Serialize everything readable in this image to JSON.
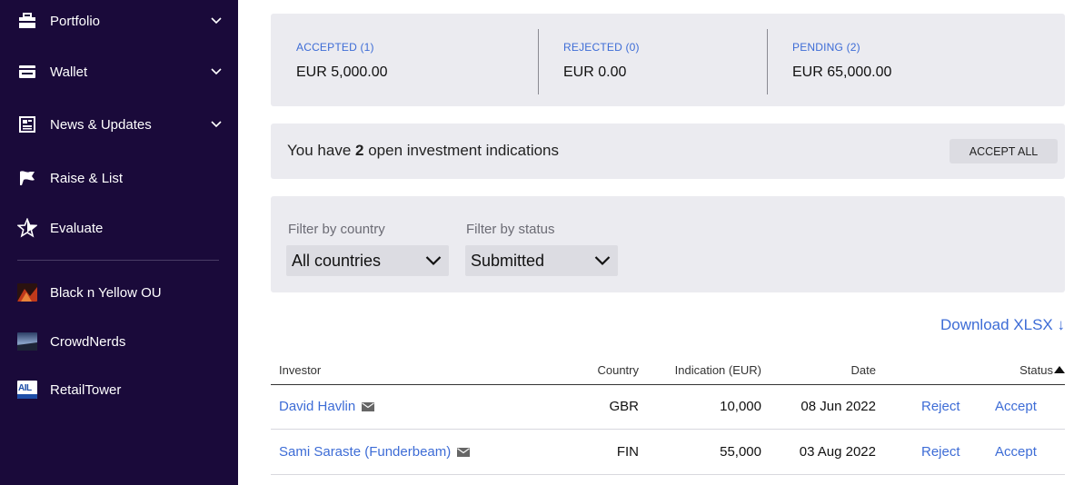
{
  "sidebar": {
    "nav": [
      {
        "label": "Portfolio",
        "icon": "briefcase-icon",
        "has_chevron": true
      },
      {
        "label": "Wallet",
        "icon": "wallet-icon",
        "has_chevron": true
      },
      {
        "label": "News & Updates",
        "icon": "newspaper-icon",
        "has_chevron": true
      },
      {
        "label": "Raise & List",
        "icon": "flag-icon",
        "has_chevron": false
      },
      {
        "label": "Evaluate",
        "icon": "star-icon",
        "has_chevron": false
      }
    ],
    "companies": [
      {
        "label": "Black n Yellow OU"
      },
      {
        "label": "CrowdNerds"
      },
      {
        "label": "RetailTower",
        "thumb_text": "AIL"
      }
    ]
  },
  "summary": {
    "accepted": {
      "label": "ACCEPTED (1)",
      "value": "EUR 5,000.00"
    },
    "rejected": {
      "label": "REJECTED (0)",
      "value": "EUR 0.00"
    },
    "pending": {
      "label": "PENDING (2)",
      "value": "EUR 65,000.00"
    }
  },
  "open": {
    "prefix": "You have",
    "count": "2",
    "suffix": "open investment indications",
    "accept_all": "ACCEPT ALL"
  },
  "filters": {
    "country": {
      "label": "Filter by country",
      "value": "All countries"
    },
    "status": {
      "label": "Filter by status",
      "value": "Submitted"
    }
  },
  "download": "Download XLSX ↓",
  "table": {
    "headers": {
      "investor": "Investor",
      "country": "Country",
      "indication": "Indication (EUR)",
      "date": "Date",
      "status": "Status"
    },
    "rows": [
      {
        "investor": "David Havlin",
        "country": "GBR",
        "indication": "10,000",
        "date": "08 Jun 2022",
        "reject": "Reject",
        "accept": "Accept"
      },
      {
        "investor": "Sami Saraste (Funderbeam)",
        "country": "FIN",
        "indication": "55,000",
        "date": "03 Aug 2022",
        "reject": "Reject",
        "accept": "Accept"
      }
    ]
  },
  "colors": {
    "sidebar_bg": "#1a0a3a",
    "accent": "#3d6cd6",
    "panel_bg": "#ebebf0"
  }
}
